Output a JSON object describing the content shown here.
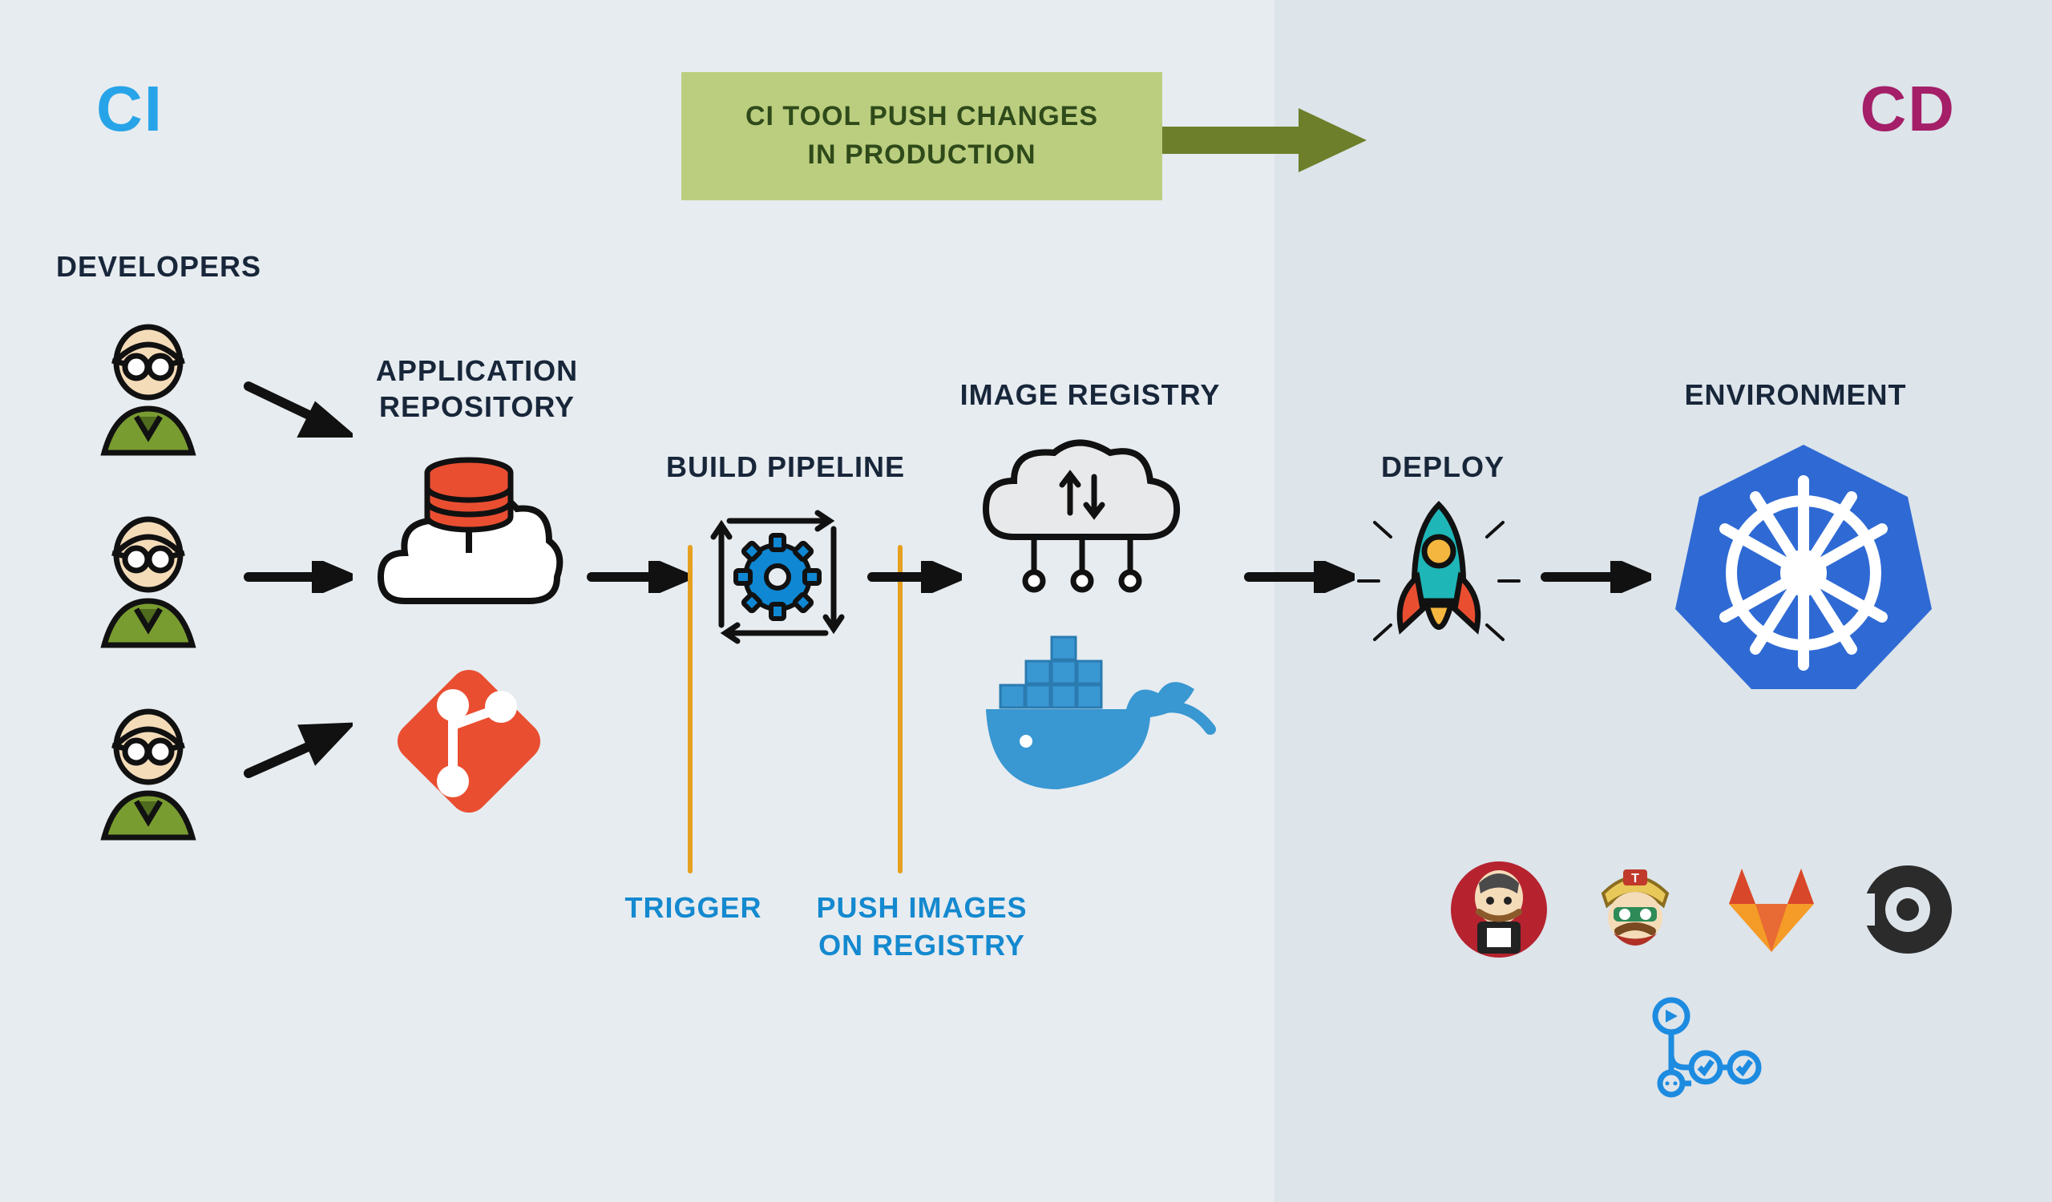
{
  "ci_label": "CI",
  "cd_label": "CD",
  "push_box_line1": "CI TOOL PUSH CHANGES",
  "push_box_line2": "IN PRODUCTION",
  "labels": {
    "developers": "DEVELOPERS",
    "app_repo_line1": "APPLICATION",
    "app_repo_line2": "REPOSITORY",
    "build_pipeline": "BUILD PIPELINE",
    "image_registry": "IMAGE REGISTRY",
    "deploy": "DEPLOY",
    "environment": "ENVIRONMENT"
  },
  "sublabels": {
    "trigger": "TRIGGER",
    "push_images_line1": "PUSH IMAGES",
    "push_images_line2": "ON REGISTRY"
  },
  "colors": {
    "ci": "#27a4e8",
    "cd": "#a41e68",
    "pushbox_bg": "#bbce7f",
    "pushbox_text": "#2f4a1a",
    "label_text": "#18263a",
    "accent_blue": "#1489cf",
    "vertical_orange": "#e6a01f",
    "git_orange": "#e94e31",
    "gear_blue": "#0f87d2",
    "docker_blue": "#3997d2",
    "k8s_blue": "#2f6ad4",
    "rocket_teal": "#1fb6b8",
    "dev_green": "#799c31"
  },
  "icons": {
    "developer": "developer-icon",
    "git": "git-icon",
    "database_cloud": "database-cloud-icon",
    "gear_cycle": "gear-cycle-icon",
    "cloud_updown": "cloud-updown-icon",
    "docker": "docker-icon",
    "rocket": "rocket-icon",
    "kubernetes": "kubernetes-icon"
  },
  "tools": [
    "jenkins",
    "travis-ci",
    "gitlab",
    "circleci",
    "github-actions"
  ]
}
